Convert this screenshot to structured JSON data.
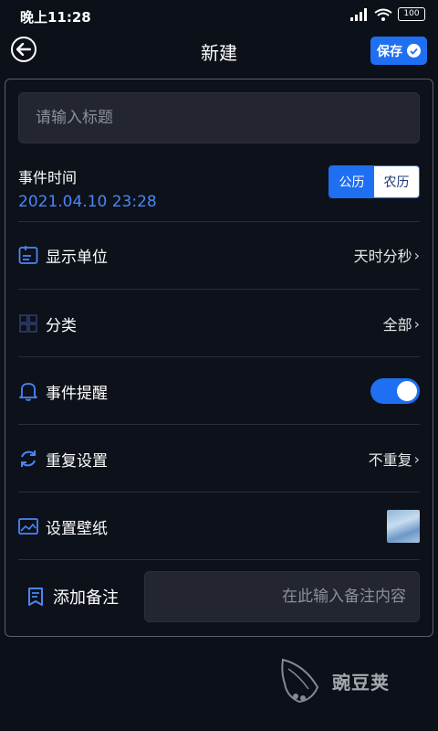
{
  "status_bar": {
    "time": "晚上11:28",
    "battery": "100"
  },
  "header": {
    "title": "新建",
    "save_label": "保存"
  },
  "title_input": {
    "placeholder": "请输入标题"
  },
  "event_time": {
    "label": "事件时间",
    "value": "2021.04.10 23:28"
  },
  "calendar_toggle": {
    "options": [
      "公历",
      "农历"
    ],
    "selected": "公历"
  },
  "rows": {
    "display_unit": {
      "label": "显示单位",
      "value": "天时分秒",
      "icon": "display-unit-icon"
    },
    "category": {
      "label": "分类",
      "value": "全部",
      "icon": "grid-icon"
    },
    "reminder": {
      "label": "事件提醒",
      "enabled": true,
      "icon": "bell-icon"
    },
    "repeat": {
      "label": "重复设置",
      "value": "不重复",
      "icon": "repeat-icon"
    },
    "wallpaper": {
      "label": "设置壁纸",
      "icon": "image-icon"
    }
  },
  "note": {
    "label": "添加备注",
    "placeholder": "在此输入备注内容",
    "icon": "bookmark-icon"
  },
  "watermark": {
    "text": "豌豆荚"
  },
  "colors": {
    "accent": "#1f6ff2",
    "background": "#0c1019",
    "input_bg": "#23262e",
    "date_text": "#4a86f7"
  }
}
